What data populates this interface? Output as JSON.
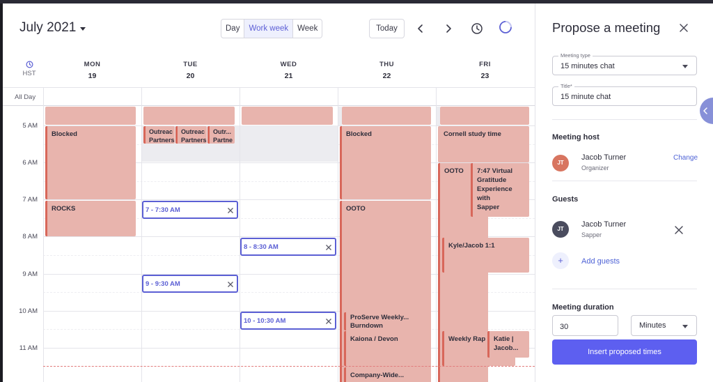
{
  "calendar": {
    "month_label": "July 2021",
    "views": [
      "Day",
      "Work week",
      "Week"
    ],
    "active_view": "Work week",
    "today_label": "Today",
    "timezone": "HST",
    "allday_label": "All Day",
    "days": [
      {
        "name": "MON",
        "date": "19"
      },
      {
        "name": "TUE",
        "date": "20"
      },
      {
        "name": "WED",
        "date": "21"
      },
      {
        "name": "THU",
        "date": "22"
      },
      {
        "name": "FRI",
        "date": "23"
      }
    ],
    "hours": [
      "5 AM",
      "6 AM",
      "7 AM",
      "8 AM",
      "9 AM",
      "10 AM",
      "11 AM"
    ],
    "events": {
      "mon_blocked": "Blocked",
      "mon_rocks": "ROCKS",
      "tue_outreach1_a": "Outreac",
      "tue_outreach1_b": "Partners",
      "tue_outreach2_a": "Outreac",
      "tue_outreach2_b": "Partners",
      "tue_outreach3_a": "Outr...",
      "tue_outreach3_b": "Partne",
      "thu_blocked": "Blocked",
      "thu_ooto": "OOTO",
      "thu_proserve_a": "ProServe Weekly...",
      "thu_proserve_b": "Burndown",
      "thu_kaiona": "Kaiona / Devon",
      "thu_company": "Company-Wide...",
      "fri_cornell": "Cornell study time",
      "fri_ooto": "OOTO",
      "fri_gratitude_1": "7:47 Virtual",
      "fri_gratitude_2": "Gratitude",
      "fri_gratitude_3": "Experience with",
      "fri_gratitude_4": "Sapper",
      "fri_kyle": "Kyle/Jacob 1:1",
      "fri_weeklyrap": "Weekly Rap",
      "fri_katie_a": "Katie |",
      "fri_katie_b": "Jacob..."
    },
    "proposed": {
      "p1": "7 - 7:30 AM",
      "p2": "8 - 8:30 AM",
      "p3": "9 - 9:30 AM",
      "p4": "10 - 10:30 AM"
    }
  },
  "panel": {
    "title": "Propose a meeting",
    "meeting_type": {
      "label": "Meeting type",
      "value": "15 minutes chat"
    },
    "title_field": {
      "label": "Title*",
      "value": "15 minute chat"
    },
    "host": {
      "heading": "Meeting host",
      "initials": "JT",
      "name": "Jacob Turner",
      "role": "Organizer",
      "change_label": "Change"
    },
    "guests": {
      "heading": "Guests",
      "initials": "JT",
      "name": "Jacob Turner",
      "org": "Sapper",
      "add_label": "Add guests",
      "add_symbol": "+"
    },
    "duration": {
      "heading": "Meeting duration",
      "value": "30",
      "unit": "Minutes"
    },
    "insert_label": "Insert proposed times"
  },
  "colors": {
    "event_bg": "#e8b4ad",
    "event_border": "#d8675a",
    "accent": "#5d5ff0",
    "link": "#4f63d6"
  }
}
